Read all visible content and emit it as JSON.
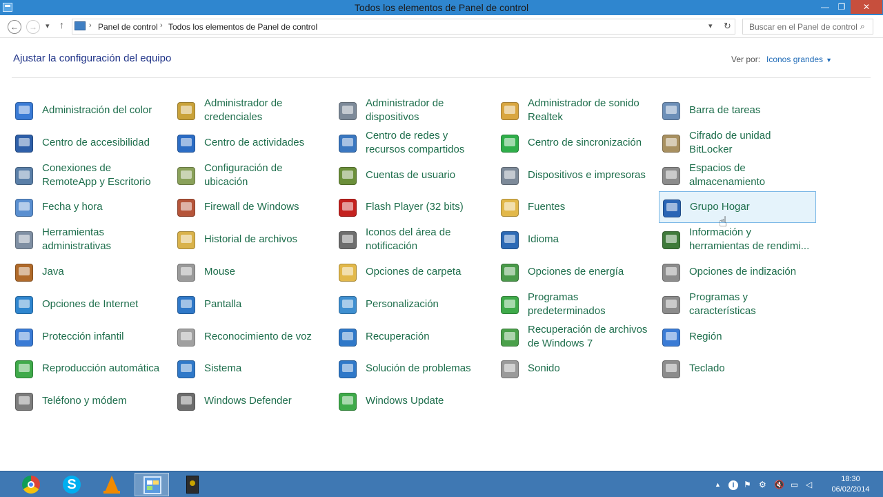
{
  "window": {
    "title": "Todos los elementos de Panel de control"
  },
  "address": {
    "crumbs": [
      "Panel de control",
      "Todos los elementos de Panel de control"
    ],
    "search_placeholder": "Buscar en el Panel de control"
  },
  "header": {
    "heading": "Ajustar la configuración del equipo",
    "view_by_label": "Ver por:",
    "view_by_value": "Iconos grandes"
  },
  "items": [
    {
      "label": "Administración del color",
      "icon": "color-management-icon",
      "color": "#3a7bd5"
    },
    {
      "label": "Administrador de credenciales",
      "icon": "credential-manager-icon",
      "color": "#c9a23a"
    },
    {
      "label": "Administrador de dispositivos",
      "icon": "device-manager-icon",
      "color": "#7d8a99"
    },
    {
      "label": "Administrador de sonido Realtek",
      "icon": "realtek-audio-icon",
      "color": "#d9a640"
    },
    {
      "label": "Barra de tareas",
      "icon": "taskbar-icon",
      "color": "#6c8fb8"
    },
    {
      "label": "Centro de accesibilidad",
      "icon": "accessibility-icon",
      "color": "#2e5fa8"
    },
    {
      "label": "Centro de actividades",
      "icon": "action-center-flag-icon",
      "color": "#2b6cc4"
    },
    {
      "label": "Centro de redes y recursos compartidos",
      "icon": "network-center-icon",
      "color": "#3a77c0"
    },
    {
      "label": "Centro de sincronización",
      "icon": "sync-center-icon",
      "color": "#2fae4a"
    },
    {
      "label": "Cifrado de unidad BitLocker",
      "icon": "bitlocker-key-icon",
      "color": "#a89060"
    },
    {
      "label": "Conexiones de RemoteApp y Escritorio",
      "icon": "remoteapp-icon",
      "color": "#5a7fa8"
    },
    {
      "label": "Configuración de ubicación",
      "icon": "location-settings-icon",
      "color": "#8aa15a"
    },
    {
      "label": "Cuentas de usuario",
      "icon": "user-accounts-icon",
      "color": "#6b8f3a"
    },
    {
      "label": "Dispositivos e impresoras",
      "icon": "devices-printers-icon",
      "color": "#7d8a99"
    },
    {
      "label": "Espacios de almacenamiento",
      "icon": "storage-spaces-icon",
      "color": "#8c8c8c"
    },
    {
      "label": "Fecha y hora",
      "icon": "date-time-icon",
      "color": "#5a8fd0"
    },
    {
      "label": "Firewall de Windows",
      "icon": "firewall-icon",
      "color": "#b5553a"
    },
    {
      "label": "Flash Player (32 bits)",
      "icon": "flash-player-icon",
      "color": "#c4221f"
    },
    {
      "label": "Fuentes",
      "icon": "fonts-folder-icon",
      "color": "#e2b84a"
    },
    {
      "label": "Grupo Hogar",
      "icon": "homegroup-icon",
      "color": "#2a65b5",
      "highlighted": true
    },
    {
      "label": "Herramientas administrativas",
      "icon": "admin-tools-icon",
      "color": "#7f8fa3"
    },
    {
      "label": "Historial de archivos",
      "icon": "file-history-icon",
      "color": "#d9b24a"
    },
    {
      "label": "Iconos del área de notificación",
      "icon": "notification-area-icon",
      "color": "#6d6d6d"
    },
    {
      "label": "Idioma",
      "icon": "language-icon",
      "color": "#2d6ab5"
    },
    {
      "label": "Información y herramientas de rendimi...",
      "icon": "performance-info-icon",
      "color": "#3f7a3a"
    },
    {
      "label": "Java",
      "icon": "java-icon",
      "color": "#b06a2a"
    },
    {
      "label": "Mouse",
      "icon": "mouse-icon",
      "color": "#9a9a9a"
    },
    {
      "label": "Opciones de carpeta",
      "icon": "folder-options-icon",
      "color": "#e2b84a"
    },
    {
      "label": "Opciones de energía",
      "icon": "power-options-icon",
      "color": "#4a9a4a"
    },
    {
      "label": "Opciones de indización",
      "icon": "indexing-options-icon",
      "color": "#8c8c8c"
    },
    {
      "label": "Opciones de Internet",
      "icon": "internet-options-icon",
      "color": "#2f86cf"
    },
    {
      "label": "Pantalla",
      "icon": "display-icon",
      "color": "#2f78c8"
    },
    {
      "label": "Personalización",
      "icon": "personalization-icon",
      "color": "#3f8fd0"
    },
    {
      "label": "Programas predeterminados",
      "icon": "default-programs-icon",
      "color": "#3faa4a"
    },
    {
      "label": "Programas y características",
      "icon": "programs-features-icon",
      "color": "#8c8c8c"
    },
    {
      "label": "Protección infantil",
      "icon": "family-safety-icon",
      "color": "#3a7bd5"
    },
    {
      "label": "Reconocimiento de voz",
      "icon": "microphone-icon",
      "color": "#a0a0a0"
    },
    {
      "label": "Recuperación",
      "icon": "recovery-icon",
      "color": "#2f78c8"
    },
    {
      "label": "Recuperación de archivos de Windows 7",
      "icon": "windows7-recovery-icon",
      "color": "#4aa04a"
    },
    {
      "label": "Región",
      "icon": "region-globe-icon",
      "color": "#3a7bd5"
    },
    {
      "label": "Reproducción automática",
      "icon": "autoplay-icon",
      "color": "#3faa4a"
    },
    {
      "label": "Sistema",
      "icon": "system-icon",
      "color": "#2f78c8"
    },
    {
      "label": "Solución de problemas",
      "icon": "troubleshooting-icon",
      "color": "#2f78c8"
    },
    {
      "label": "Sonido",
      "icon": "sound-speaker-icon",
      "color": "#9a9a9a"
    },
    {
      "label": "Teclado",
      "icon": "keyboard-icon",
      "color": "#8c8c8c"
    },
    {
      "label": "Teléfono y módem",
      "icon": "phone-modem-icon",
      "color": "#7d7d7d"
    },
    {
      "label": "Windows Defender",
      "icon": "windows-defender-icon",
      "color": "#6d6d6d"
    },
    {
      "label": "Windows Update",
      "icon": "windows-update-icon",
      "color": "#3faa4a"
    }
  ],
  "taskbar": {
    "apps": [
      {
        "name": "chrome",
        "icon": "chrome-icon"
      },
      {
        "name": "skype",
        "icon": "skype-icon"
      },
      {
        "name": "vlc",
        "icon": "vlc-icon"
      },
      {
        "name": "control-panel",
        "icon": "control-panel-icon",
        "active": true
      },
      {
        "name": "camtasia",
        "icon": "recorder-icon"
      }
    ],
    "time": "18:30",
    "date": "06/02/2014"
  },
  "colors": {
    "titlebar": "#2f86cf",
    "taskbar": "#3f78b3",
    "item_text": "#1e6e4c",
    "heading": "#1e3287",
    "link": "#1e6ab7"
  }
}
